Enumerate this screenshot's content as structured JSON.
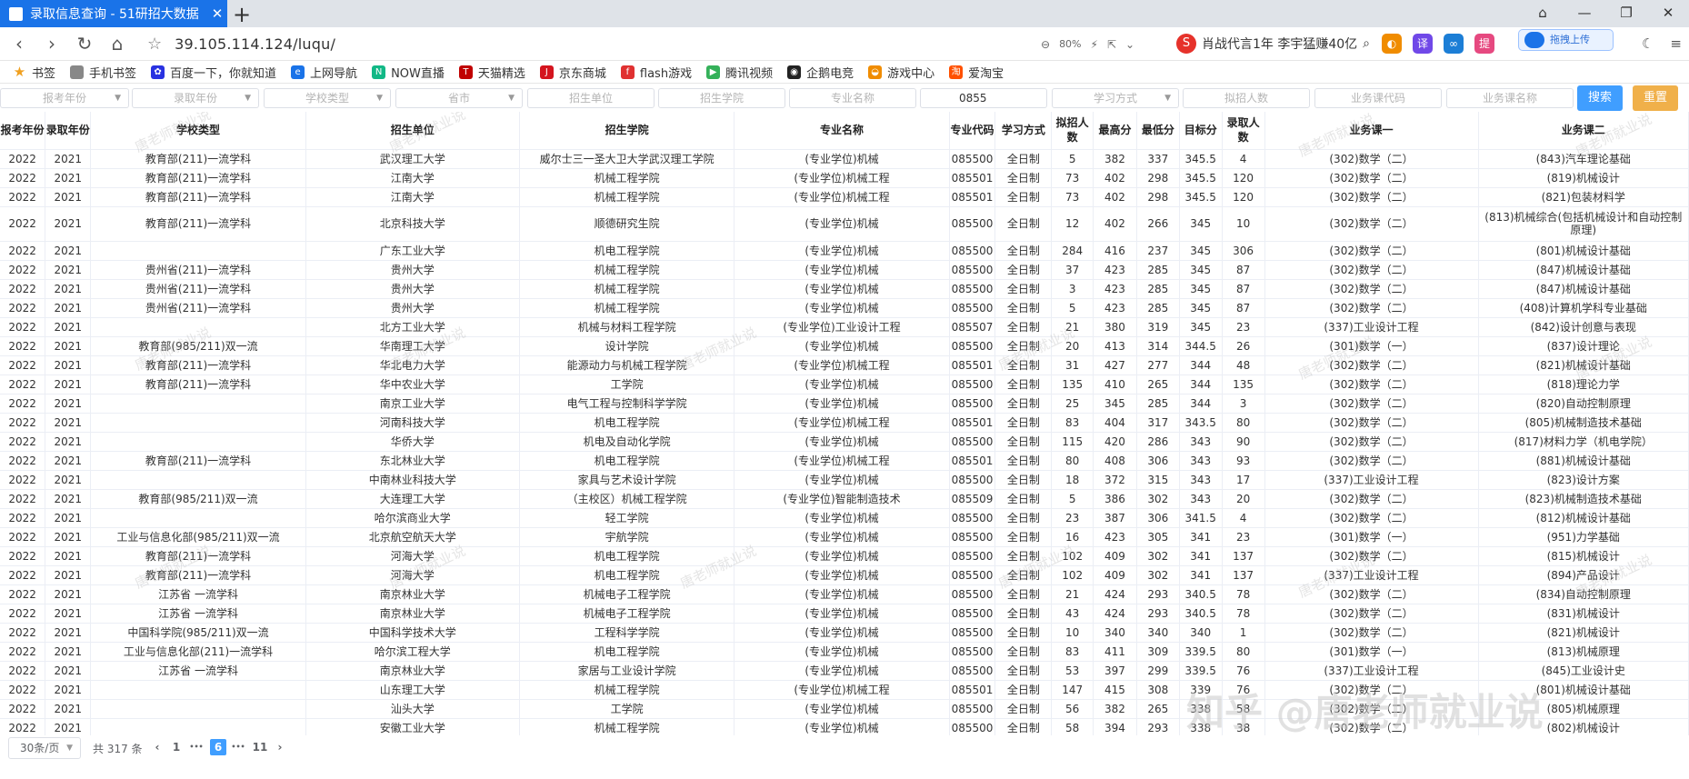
{
  "browser": {
    "tab_title": "录取信息查询 - 51研招大数据",
    "tab_close": "✕",
    "new_tab": "+",
    "url": "39.105.114.124/luqu/",
    "zoom": "80%",
    "news": "肖战代言1年 李宇猛赚40亿",
    "upload_label": "拖拽上传",
    "bookmarks": [
      {
        "label": "书签",
        "icon": "star-icon",
        "color": "#f0a020"
      },
      {
        "label": "手机书签",
        "icon": "phone-icon",
        "color": "#888888"
      },
      {
        "label": "百度一下，你就知道",
        "icon": "baidu-icon",
        "color": "#2932e1"
      },
      {
        "label": "上网导航",
        "icon": "ie-icon",
        "color": "#1a73e8"
      },
      {
        "label": "NOW直播",
        "icon": "now-icon",
        "color": "#12b886"
      },
      {
        "label": "天猫精选",
        "icon": "tmall-icon",
        "color": "#c00000"
      },
      {
        "label": "京东商城",
        "icon": "jd-icon",
        "color": "#d4141e"
      },
      {
        "label": "flash游戏",
        "icon": "flash-icon",
        "color": "#e03131"
      },
      {
        "label": "腾讯视频",
        "icon": "play-icon",
        "color": "#35b15a"
      },
      {
        "label": "企鹅电竞",
        "icon": "penguin-icon",
        "color": "#222222"
      },
      {
        "label": "游戏中心",
        "icon": "gamepad-icon",
        "color": "#f08c00"
      },
      {
        "label": "爱淘宝",
        "icon": "taobao-icon",
        "color": "#ff5000"
      }
    ]
  },
  "filters": {
    "year_apply": "报考年份",
    "year_admit": "录取年份",
    "school_type": "学校类型",
    "province": "省市",
    "unit": "招生单位",
    "college": "招生学院",
    "major_name": "专业名称",
    "major_code": "0855",
    "study_mode": "学习方式",
    "plan": "拟招人数",
    "course_code": "业务课代码",
    "course_name": "业务课名称",
    "search": "搜索",
    "reset": "重置"
  },
  "table": {
    "headers": [
      "报考年份",
      "录取年份",
      "学校类型",
      "招生单位",
      "招生学院",
      "专业名称",
      "专业代码",
      "学习方式",
      "拟招人数",
      "最高分",
      "最低分",
      "目标分",
      "录取人数",
      "业务课一",
      "业务课二"
    ],
    "rows": [
      [
        "2022",
        "2021",
        "教育部(211)一流学科",
        "武汉理工大学",
        "威尔士三一圣大卫大学武汉理工学院",
        "(专业学位)机械",
        "085500",
        "全日制",
        "5",
        "382",
        "337",
        "345.5",
        "4",
        "(302)数学（二）",
        "(843)汽车理论基础"
      ],
      [
        "2022",
        "2021",
        "教育部(211)一流学科",
        "江南大学",
        "机械工程学院",
        "(专业学位)机械工程",
        "085501",
        "全日制",
        "73",
        "402",
        "298",
        "345.5",
        "120",
        "(302)数学（二）",
        "(819)机械设计"
      ],
      [
        "2022",
        "2021",
        "教育部(211)一流学科",
        "江南大学",
        "机械工程学院",
        "(专业学位)机械工程",
        "085501",
        "全日制",
        "73",
        "402",
        "298",
        "345.5",
        "120",
        "(302)数学（二）",
        "(821)包装材料学"
      ],
      [
        "2022",
        "2021",
        "教育部(211)一流学科",
        "北京科技大学",
        "顺德研究生院",
        "(专业学位)机械",
        "085500",
        "全日制",
        "12",
        "402",
        "266",
        "345",
        "10",
        "(302)数学（二）",
        "(813)机械综合(包括机械设计和自动控制原理)"
      ],
      [
        "2022",
        "2021",
        "",
        "广东工业大学",
        "机电工程学院",
        "(专业学位)机械",
        "085500",
        "全日制",
        "284",
        "416",
        "237",
        "345",
        "306",
        "(302)数学（二）",
        "(801)机械设计基础"
      ],
      [
        "2022",
        "2021",
        "贵州省(211)一流学科",
        "贵州大学",
        "机械工程学院",
        "(专业学位)机械",
        "085500",
        "全日制",
        "37",
        "423",
        "285",
        "345",
        "87",
        "(302)数学（二）",
        "(847)机械设计基础"
      ],
      [
        "2022",
        "2021",
        "贵州省(211)一流学科",
        "贵州大学",
        "机械工程学院",
        "(专业学位)机械",
        "085500",
        "全日制",
        "3",
        "423",
        "285",
        "345",
        "87",
        "(302)数学（二）",
        "(847)机械设计基础"
      ],
      [
        "2022",
        "2021",
        "贵州省(211)一流学科",
        "贵州大学",
        "机械工程学院",
        "(专业学位)机械",
        "085500",
        "全日制",
        "5",
        "423",
        "285",
        "345",
        "87",
        "(302)数学（二）",
        "(408)计算机学科专业基础"
      ],
      [
        "2022",
        "2021",
        "",
        "北方工业大学",
        "机械与材料工程学院",
        "(专业学位)工业设计工程",
        "085507",
        "全日制",
        "21",
        "380",
        "319",
        "345",
        "23",
        "(337)工业设计工程",
        "(842)设计创意与表现"
      ],
      [
        "2022",
        "2021",
        "教育部(985/211)双一流",
        "华南理工大学",
        "设计学院",
        "(专业学位)机械",
        "085500",
        "全日制",
        "20",
        "413",
        "314",
        "344.5",
        "26",
        "(301)数学（一）",
        "(837)设计理论"
      ],
      [
        "2022",
        "2021",
        "教育部(211)一流学科",
        "华北电力大学",
        "能源动力与机械工程学院",
        "(专业学位)机械工程",
        "085501",
        "全日制",
        "31",
        "427",
        "277",
        "344",
        "48",
        "(302)数学（二）",
        "(821)机械设计基础"
      ],
      [
        "2022",
        "2021",
        "教育部(211)一流学科",
        "华中农业大学",
        "工学院",
        "(专业学位)机械",
        "085500",
        "全日制",
        "135",
        "410",
        "265",
        "344",
        "135",
        "(302)数学（二）",
        "(818)理论力学"
      ],
      [
        "2022",
        "2021",
        "",
        "南京工业大学",
        "电气工程与控制科学学院",
        "(专业学位)机械",
        "085500",
        "全日制",
        "25",
        "345",
        "285",
        "344",
        "3",
        "(302)数学（二）",
        "(820)自动控制原理"
      ],
      [
        "2022",
        "2021",
        "",
        "河南科技大学",
        "机电工程学院",
        "(专业学位)机械工程",
        "085501",
        "全日制",
        "83",
        "404",
        "317",
        "343.5",
        "80",
        "(302)数学（二）",
        "(805)机械制造技术基础"
      ],
      [
        "2022",
        "2021",
        "",
        "华侨大学",
        "机电及自动化学院",
        "(专业学位)机械",
        "085500",
        "全日制",
        "115",
        "420",
        "286",
        "343",
        "90",
        "(302)数学（二）",
        "(817)材料力学（机电学院）"
      ],
      [
        "2022",
        "2021",
        "教育部(211)一流学科",
        "东北林业大学",
        "机电工程学院",
        "(专业学位)机械工程",
        "085501",
        "全日制",
        "80",
        "408",
        "306",
        "343",
        "93",
        "(302)数学（二）",
        "(881)机械设计基础"
      ],
      [
        "2022",
        "2021",
        "",
        "中南林业科技大学",
        "家具与艺术设计学院",
        "(专业学位)机械",
        "085500",
        "全日制",
        "18",
        "372",
        "315",
        "343",
        "17",
        "(337)工业设计工程",
        "(823)设计方案"
      ],
      [
        "2022",
        "2021",
        "教育部(985/211)双一流",
        "大连理工大学",
        "（主校区）机械工程学院",
        "(专业学位)智能制造技术",
        "085509",
        "全日制",
        "5",
        "386",
        "302",
        "343",
        "20",
        "(302)数学（二）",
        "(823)机械制造技术基础"
      ],
      [
        "2022",
        "2021",
        "",
        "哈尔滨商业大学",
        "轻工学院",
        "(专业学位)机械",
        "085500",
        "全日制",
        "23",
        "387",
        "306",
        "341.5",
        "4",
        "(302)数学（二）",
        "(812)机械设计基础"
      ],
      [
        "2022",
        "2021",
        "工业与信息化部(985/211)双一流",
        "北京航空航天大学",
        "宇航学院",
        "(专业学位)机械",
        "085500",
        "全日制",
        "16",
        "423",
        "305",
        "341",
        "23",
        "(301)数学（一）",
        "(951)力学基础"
      ],
      [
        "2022",
        "2021",
        "教育部(211)一流学科",
        "河海大学",
        "机电工程学院",
        "(专业学位)机械",
        "085500",
        "全日制",
        "102",
        "409",
        "302",
        "341",
        "137",
        "(302)数学（二）",
        "(815)机械设计"
      ],
      [
        "2022",
        "2021",
        "教育部(211)一流学科",
        "河海大学",
        "机电工程学院",
        "(专业学位)机械",
        "085500",
        "全日制",
        "102",
        "409",
        "302",
        "341",
        "137",
        "(337)工业设计工程",
        "(894)产品设计"
      ],
      [
        "2022",
        "2021",
        "江苏省 一流学科",
        "南京林业大学",
        "机械电子工程学院",
        "(专业学位)机械",
        "085500",
        "全日制",
        "21",
        "424",
        "293",
        "340.5",
        "78",
        "(302)数学（二）",
        "(834)自动控制原理"
      ],
      [
        "2022",
        "2021",
        "江苏省 一流学科",
        "南京林业大学",
        "机械电子工程学院",
        "(专业学位)机械",
        "085500",
        "全日制",
        "43",
        "424",
        "293",
        "340.5",
        "78",
        "(302)数学（二）",
        "(831)机械设计"
      ],
      [
        "2022",
        "2021",
        "中国科学院(985/211)双一流",
        "中国科学技术大学",
        "工程科学学院",
        "(专业学位)机械",
        "085500",
        "全日制",
        "10",
        "340",
        "340",
        "340",
        "1",
        "(302)数学（二）",
        "(821)机械设计"
      ],
      [
        "2022",
        "2021",
        "工业与信息化部(211)一流学科",
        "哈尔滨工程大学",
        "机电工程学院",
        "(专业学位)机械",
        "085500",
        "全日制",
        "83",
        "411",
        "309",
        "339.5",
        "80",
        "(301)数学（一）",
        "(813)机械原理"
      ],
      [
        "2022",
        "2021",
        "江苏省 一流学科",
        "南京林业大学",
        "家居与工业设计学院",
        "(专业学位)机械",
        "085500",
        "全日制",
        "53",
        "397",
        "299",
        "339.5",
        "76",
        "(337)工业设计工程",
        "(845)工业设计史"
      ],
      [
        "2022",
        "2021",
        "",
        "山东理工大学",
        "机械工程学院",
        "(专业学位)机械工程",
        "085501",
        "全日制",
        "147",
        "415",
        "308",
        "339",
        "76",
        "(302)数学（二）",
        "(801)机械设计基础"
      ],
      [
        "2022",
        "2021",
        "",
        "汕头大学",
        "工学院",
        "(专业学位)机械",
        "085500",
        "全日制",
        "56",
        "382",
        "265",
        "338",
        "58",
        "(302)数学（二）",
        "(805)机械原理"
      ],
      [
        "2022",
        "2021",
        "",
        "安徽工业大学",
        "机械工程学院",
        "(专业学位)机械",
        "085500",
        "全日制",
        "58",
        "394",
        "293",
        "338",
        "38",
        "(302)数学（二）",
        "(802)机械设计"
      ]
    ]
  },
  "pagination": {
    "page_size": "30条/页",
    "total": "共 317 条",
    "prev": "‹",
    "first": "1",
    "ellipsis_left": "•••",
    "current": "6",
    "ellipsis_right": "•••",
    "last": "11",
    "next": "›"
  },
  "watermark": "唐老师就业说",
  "zhihu_watermark": "知乎 @唐老师就业说"
}
